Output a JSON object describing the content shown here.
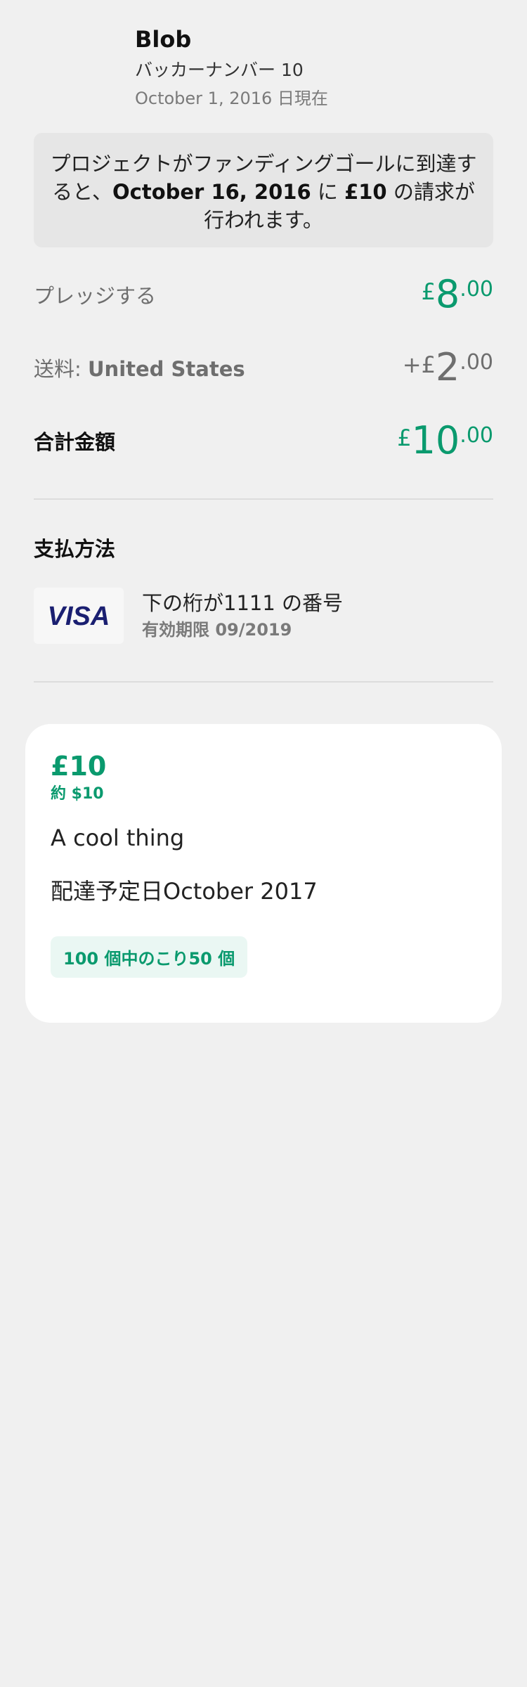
{
  "header": {
    "backer_name": "Blob",
    "backer_number": "バッカーナンバー 10",
    "as_of": "October 1, 2016 日現在"
  },
  "notice": {
    "text_before": "プロジェクトがファンディングゴールに到達すると、",
    "date": "October 16, 2016",
    "text_mid": " に ",
    "amount": "£10",
    "text_after": " の請求が行われます。"
  },
  "pledge": {
    "label": "プレッジする",
    "currency": "£",
    "whole": "8",
    "cents": ".00"
  },
  "shipping": {
    "label": "送料: ",
    "location": "United States",
    "sign": "+",
    "currency": "£",
    "whole": "2",
    "cents": ".00"
  },
  "total": {
    "label": "合計金額",
    "currency": "£",
    "whole": "10",
    "cents": ".00"
  },
  "payment": {
    "title": "支払方法",
    "card_brand": "VISA",
    "card_line": "下の桁が1111 の番号",
    "expiry": "有効期限 09/2019"
  },
  "reward": {
    "price": "£10",
    "approx": "約 $10",
    "title": "A cool thing",
    "delivery": "配達予定日October 2017",
    "remaining": "100 個中のこり50 個"
  },
  "colors": {
    "accent_green": "#0a9a6e",
    "background": "#f0f0f0",
    "visa_blue": "#1a1f71"
  }
}
